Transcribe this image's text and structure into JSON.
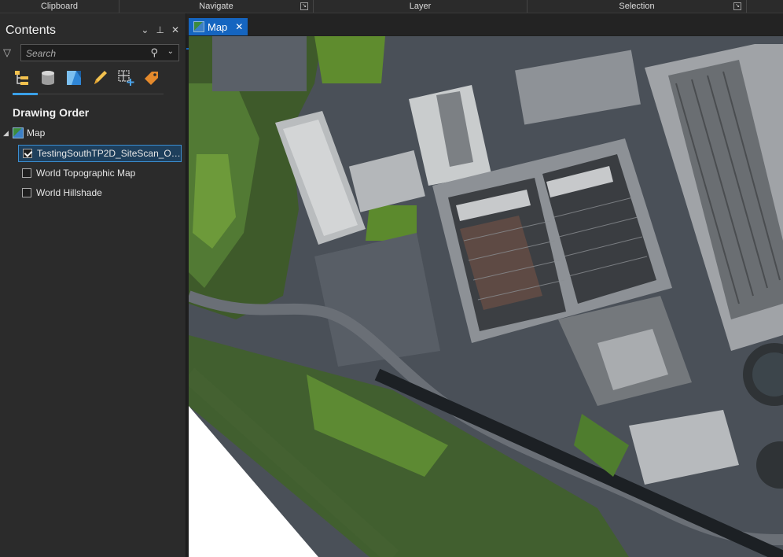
{
  "ribbon": {
    "groups": [
      "Clipboard",
      "Navigate",
      "Layer",
      "Selection"
    ]
  },
  "contents": {
    "title": "Contents",
    "search_placeholder": "Search",
    "section_title": "Drawing Order",
    "map_node": "Map",
    "layers": [
      {
        "label": "TestingSouthTP2D_SiteScan_Orth...",
        "checked": true
      },
      {
        "label": "World Topographic Map",
        "checked": false
      },
      {
        "label": "World Hillshade",
        "checked": false
      }
    ],
    "tool_icons": [
      "list-by-drawing-order-icon",
      "list-by-data-source-icon",
      "list-by-visibility-icon",
      "list-by-editing-icon",
      "list-by-selection-icon",
      "list-by-labeling-icon"
    ]
  },
  "map_tab": {
    "label": "Map"
  },
  "colors": {
    "accent": "#1565c0",
    "selection": "#3b8ed1"
  }
}
